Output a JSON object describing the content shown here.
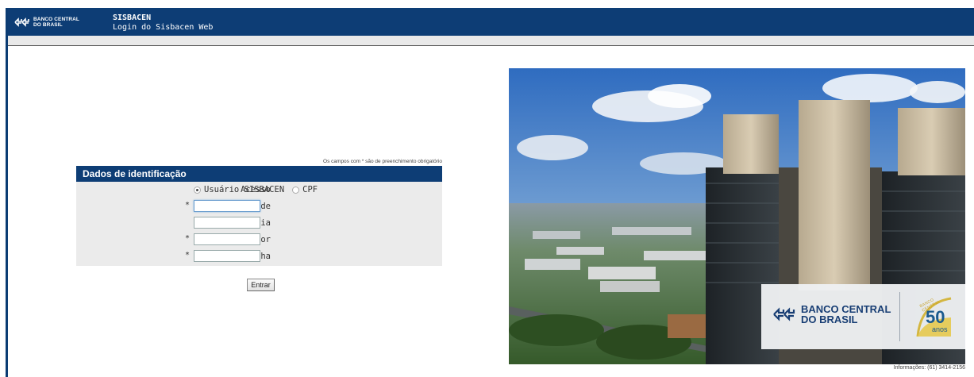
{
  "header": {
    "logo_line1": "BANCO CENTRAL",
    "logo_line2": "DO BRASIL",
    "title": "SISBACEN",
    "subtitle": "Login do Sisbacen Web"
  },
  "form": {
    "required_note": "Os campos com * são de preenchimento obrigatório",
    "section_title": "Dados de identificação",
    "acesso": {
      "label": "Acesso",
      "options": [
        "Usuário SISBACEN",
        "CPF"
      ],
      "selected": "Usuário SISBACEN"
    },
    "fields": [
      {
        "label": "Unidade",
        "required": "*",
        "value": ""
      },
      {
        "label": "Dependência",
        "required": "",
        "value": ""
      },
      {
        "label": "Operador",
        "required": "*",
        "value": ""
      },
      {
        "label": "Senha",
        "required": "*",
        "value": ""
      }
    ],
    "submit_label": "Entrar"
  },
  "photo": {
    "brand_line1": "BANCO CENTRAL",
    "brand_line2": "DO BRASIL",
    "seal_number": "50",
    "seal_word": "anos",
    "seal_arc_text": "BANCO CENTRAL"
  },
  "footer": {
    "info": "Informações: (61) 3414-2156"
  },
  "colors": {
    "header_blue": "#0d3d75",
    "form_bg": "#ebebeb"
  }
}
